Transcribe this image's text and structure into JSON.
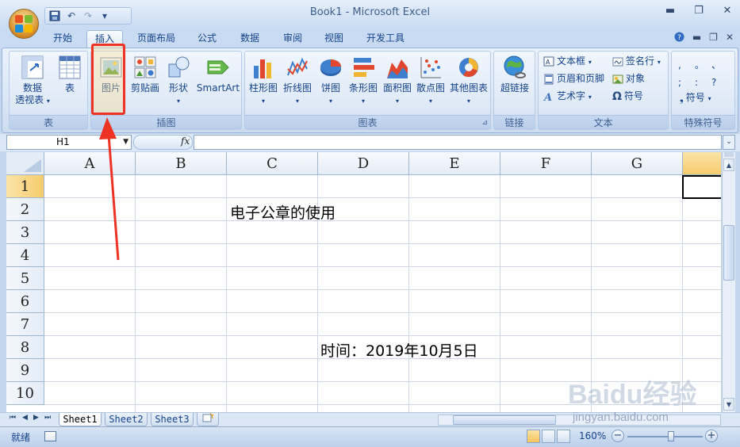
{
  "window": {
    "title": "Book1 - Microsoft Excel",
    "minimize": "▬",
    "maximize": "❐",
    "close": "✕"
  },
  "tabs": [
    "开始",
    "插入",
    "页面布局",
    "公式",
    "数据",
    "审阅",
    "视图",
    "开发工具"
  ],
  "active_tab": "插入",
  "ribbon": {
    "groups": {
      "table": "表",
      "illustrations": "插图",
      "charts": "图表",
      "links": "链接",
      "text": "文本",
      "special_symbols": "特殊符号"
    },
    "buttons": {
      "pivot_line1": "数据",
      "pivot_line2": "透视表",
      "table": "表",
      "picture": "图片",
      "clipart": "剪贴画",
      "shapes": "形状",
      "smartart": "SmartArt",
      "column": "柱形图",
      "line": "折线图",
      "pie": "饼图",
      "bar": "条形图",
      "area": "面积图",
      "scatter": "散点图",
      "other": "其他图表",
      "hyperlink": "超链接",
      "textbox": "文本框",
      "header_footer": "页眉和页脚",
      "wordart": "艺术字",
      "signature": "签名行",
      "object": "对象",
      "symbol": "符号",
      "symbol_special": "符号"
    }
  },
  "formula_bar": {
    "name_box": "H1",
    "fx": "fx",
    "value": ""
  },
  "grid": {
    "columns": [
      "A",
      "B",
      "C",
      "D",
      "E",
      "F",
      "G"
    ],
    "rows": [
      "1",
      "2",
      "3",
      "4",
      "5",
      "6",
      "7",
      "8",
      "9",
      "10"
    ],
    "cells": {
      "C2": "电子公章的使用",
      "D8": "时间：2019年10月5日"
    }
  },
  "sheets": [
    "Sheet1",
    "Sheet2",
    "Sheet3"
  ],
  "active_sheet": "Sheet1",
  "status": {
    "ready": "就绪",
    "zoom": "160%"
  },
  "watermark": {
    "brand": "Baidu经验",
    "url": "jingyan.baidu.com"
  },
  "colors": {
    "accent": "#ee3224",
    "ribbon": "#dbe7f6",
    "selection": "#f7cb6d"
  }
}
